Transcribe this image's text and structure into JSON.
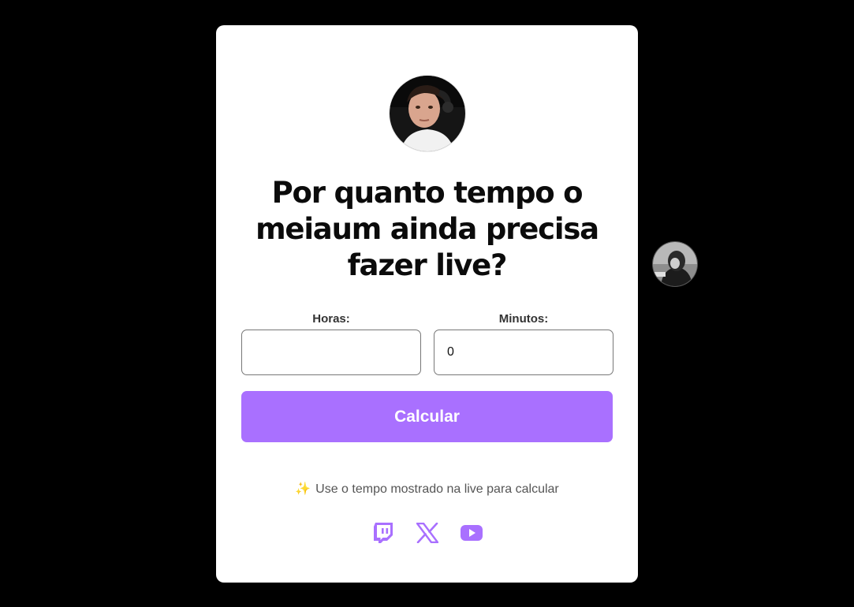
{
  "colors": {
    "background": "#000000",
    "card": "#ffffff",
    "accent": "#a970ff",
    "title": "#0b0b0b",
    "hint": "#555555"
  },
  "avatar": {
    "icon": "streamer-avatar"
  },
  "title": "Por quanto tempo o meiaum ainda precisa fazer live?",
  "form": {
    "hours_label": "Horas:",
    "hours_value": "",
    "minutes_label": "Minutos:",
    "minutes_value": "0",
    "submit_label": "Calcular"
  },
  "hint": {
    "icon": "✨",
    "text": "Use o tempo mostrado na live para calcular"
  },
  "socials": [
    {
      "icon": "twitch-icon"
    },
    {
      "icon": "x-icon"
    },
    {
      "icon": "youtube-icon"
    }
  ],
  "side_avatar": {
    "icon": "side-avatar"
  }
}
